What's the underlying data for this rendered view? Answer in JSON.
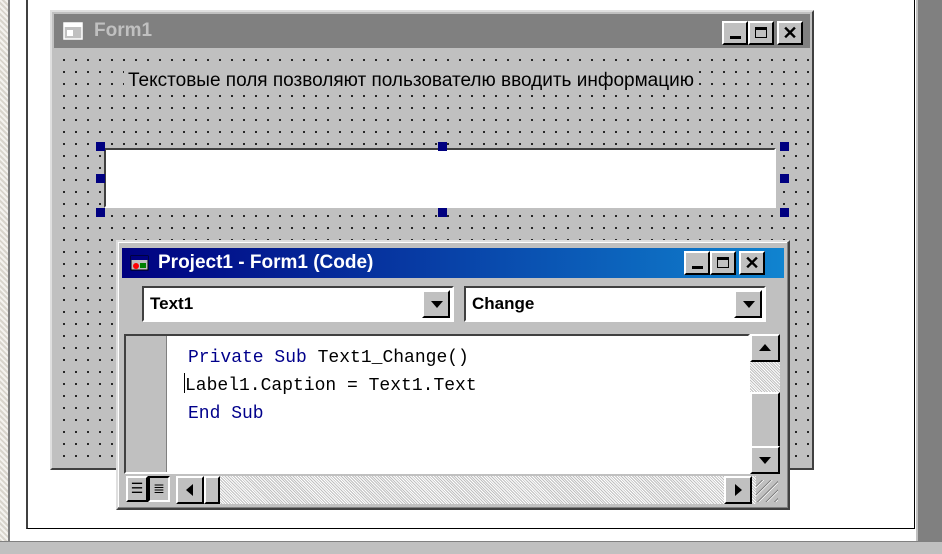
{
  "form1": {
    "title": "Form1",
    "label1_caption": "Текстовые поля позволяют пользователю вводить информацию"
  },
  "code_window": {
    "title": "Project1 - Form1 (Code)",
    "object_combo_value": "Text1",
    "procedure_combo_value": "Change",
    "code_line_1_kw": "Private Sub",
    "code_line_1_rest": " Text1_Change()",
    "code_line_2": "Label1.Caption = Text1.Text",
    "code_line_3": "End Sub"
  },
  "colors": {
    "active_title_start": "#000080",
    "active_title_end": "#1084d0",
    "inactive_title": "#808080",
    "keyword": "#00008b",
    "face": "#c0c0c0",
    "selection_handle": "#000080"
  },
  "icons": {
    "form_icon": "form-icon",
    "code_window_icon": "code-window-icon",
    "minimize": "minimize-icon",
    "maximize": "maximize-icon",
    "close": "close-icon",
    "procedure_view": "procedure-view-icon",
    "full_module_view": "full-module-view-icon"
  }
}
